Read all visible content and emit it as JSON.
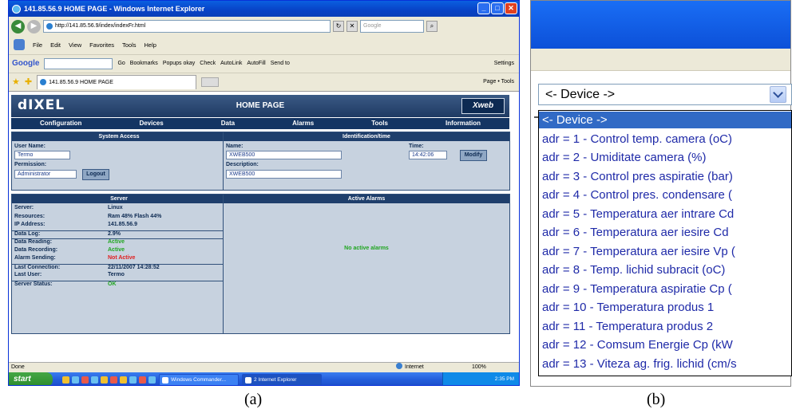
{
  "panel_a": {
    "window_title": "141.85.56.9 HOME PAGE - Windows Internet Explorer",
    "address": "http://141.85.56.9/index/indexFr.html",
    "search_placeholder": "Google",
    "menu": [
      "File",
      "Edit",
      "View",
      "Favorites",
      "Tools",
      "Help"
    ],
    "google_toolbar": {
      "logo": "Google",
      "go": "Go",
      "bookmarks": "Bookmarks",
      "popups": "Popups okay",
      "check": "Check",
      "autolink": "AutoLink",
      "autofill": "AutoFill",
      "sendto": "Send to",
      "settings": "Settings"
    },
    "tab_label": "141.85.56.9 HOME PAGE",
    "tab_tools": "Page • Tools",
    "page": {
      "logo": "dIXEL",
      "title": "HOME PAGE",
      "badge": "Xweb",
      "nav": [
        "Configuration",
        "Devices",
        "Data",
        "Alarms",
        "Tools",
        "Information"
      ],
      "system_access": {
        "header": "System Access",
        "user_label": "User Name:",
        "user_value": "Termo",
        "permission_label": "Permission:",
        "permission_value": "Administrator",
        "logout": "Logout"
      },
      "identification": {
        "header": "Identification/time",
        "name_label": "Name:",
        "name_value": "XWEB500",
        "desc_label": "Description:",
        "desc_value": "XWEB500",
        "time_label": "Time:",
        "time_value": "14:42:06",
        "modify": "Modify"
      },
      "server": {
        "header": "Server",
        "rows": [
          {
            "k": "Server:",
            "v": "Linux",
            "c": ""
          },
          {
            "k": "Resources:",
            "v": "Ram 48% Flash 44%",
            "c": ""
          },
          {
            "k": "IP Address:",
            "v": "141.85.56.9",
            "c": ""
          },
          {
            "k": "Data Log:",
            "v": "2.9%",
            "c": ""
          },
          {
            "k": "Data Reading:",
            "v": "Active",
            "c": "green"
          },
          {
            "k": "Data Recording:",
            "v": "Active",
            "c": "green"
          },
          {
            "k": "Alarm Sending:",
            "v": "Not Active",
            "c": "red"
          },
          {
            "k": "Last Connection:",
            "v": "22/11/2007 14:28:52",
            "c": ""
          },
          {
            "k": "Last User:",
            "v": "Termo",
            "c": ""
          },
          {
            "k": "Server Status:",
            "v": "OK",
            "c": "green"
          }
        ]
      },
      "alarms": {
        "header": "Active Alarms",
        "empty": "No active alarms"
      }
    },
    "status": {
      "left": "Done",
      "zone": "Internet",
      "zoom": "100%"
    },
    "taskbar": {
      "start": "start",
      "items": [
        "Windows Commander...",
        "2 Internet Explorer"
      ],
      "clock": "2:35 PM"
    },
    "caption": "(a)"
  },
  "panel_b": {
    "select_value": "<- Device ->",
    "options": [
      "<- Device ->",
      "adr = 1 - Control temp. camera (oC)",
      "adr = 2 - Umiditate camera (%)",
      "adr = 3 - Control pres aspiratie (bar)",
      "adr = 4 - Control pres. condensare (",
      "adr = 5 - Temperatura aer intrare Cd",
      "adr = 6 - Temperatura aer iesire Cd",
      "adr = 7 - Temperatura aer iesire Vp (",
      "adr = 8 - Temp. lichid subracit (oC)",
      "adr = 9 - Temperatura aspiratie Cp (",
      "adr = 10 - Temperatura produs 1",
      "adr = 11 - Temperatura produs 2",
      "adr = 12 - Comsum Energie Cp (kW",
      "adr = 13 - Viteza ag. frig. lichid (cm/s"
    ],
    "selected_index": 0,
    "caption": "(b)"
  }
}
